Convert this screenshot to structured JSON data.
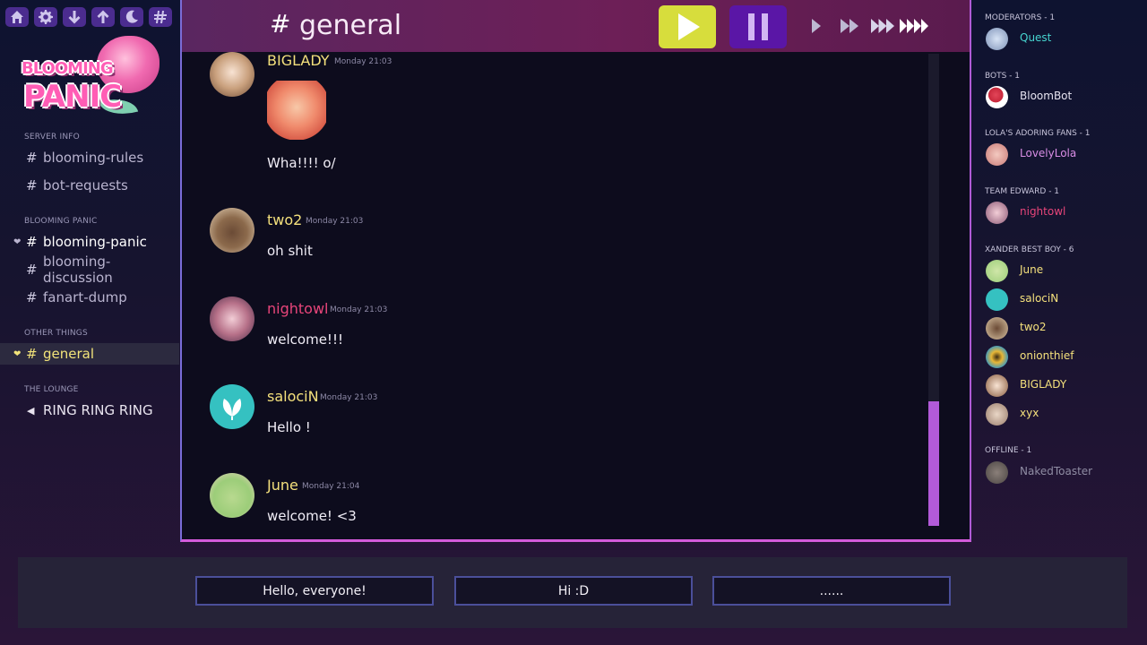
{
  "toolbar": {
    "icons": [
      "home-icon",
      "gear-icon",
      "arrow-down-icon",
      "arrow-up-icon",
      "moon-icon",
      "hashtag-icon"
    ]
  },
  "logo": {
    "line1": "BLOOMING",
    "line2": "PANIC"
  },
  "sidebar": {
    "sections": [
      {
        "title": "SERVER INFO"
      },
      {
        "title": "BLOOMING PANIC"
      },
      {
        "title": "OTHER THINGS"
      },
      {
        "title": "THE LOUNGE"
      }
    ],
    "channels": [
      {
        "name": "blooming-rules"
      },
      {
        "name": "bot-requests"
      },
      {
        "name": "blooming-panic"
      },
      {
        "name": "blooming-discussion"
      },
      {
        "name": "fanart-dump"
      },
      {
        "name": "general"
      },
      {
        "name": "RING RING RING"
      }
    ]
  },
  "header": {
    "hash": "#",
    "channel": "general"
  },
  "messages": [
    {
      "author": "BIGLADY",
      "time": "Monday 21:03",
      "text": "Wha!!!! o/"
    },
    {
      "author": "two2",
      "time": "Monday 21:03",
      "text": "oh shit"
    },
    {
      "author": "nightowl",
      "time": "Monday 21:03",
      "text": "welcome!!!"
    },
    {
      "author": "salociN",
      "time": "Monday 21:03",
      "text": "Hello !"
    },
    {
      "author": "June",
      "time": "Monday 21:04",
      "text": "welcome! <3"
    }
  ],
  "members": {
    "groups": [
      {
        "title": "MODERATORS - 1",
        "members": [
          {
            "name": "Quest",
            "color": "#46d4cf"
          }
        ]
      },
      {
        "title": "BOTS - 1",
        "members": [
          {
            "name": "BloomBot",
            "color": "#e6e3f0"
          }
        ]
      },
      {
        "title": "LOLA'S ADORING FANS - 1",
        "members": [
          {
            "name": "LovelyLola",
            "color": "#d98ee6"
          }
        ]
      },
      {
        "title": "TEAM EDWARD - 1",
        "members": [
          {
            "name": "nightowl",
            "color": "#e8457a"
          }
        ]
      },
      {
        "title": "XANDER BEST BOY - 6",
        "members": [
          {
            "name": "June",
            "color": "#f4e07c"
          },
          {
            "name": "salociN",
            "color": "#f4e07c"
          },
          {
            "name": "two2",
            "color": "#f4e07c"
          },
          {
            "name": "onionthief",
            "color": "#f4e07c"
          },
          {
            "name": "BIGLADY",
            "color": "#f4e07c"
          },
          {
            "name": "xyx",
            "color": "#f4e07c"
          }
        ]
      },
      {
        "title": "OFFLINE - 1",
        "members": [
          {
            "name": "NakedToaster",
            "color": "#8f8ca3"
          }
        ]
      }
    ]
  },
  "choices": [
    "Hello, everyone!",
    "Hi :D",
    "......"
  ],
  "colors": {
    "accent_yellow": "#f4e07c",
    "accent_purple": "#b25ad9",
    "play_button": "#d7dd3c",
    "pause_button": "#5a16a6"
  }
}
